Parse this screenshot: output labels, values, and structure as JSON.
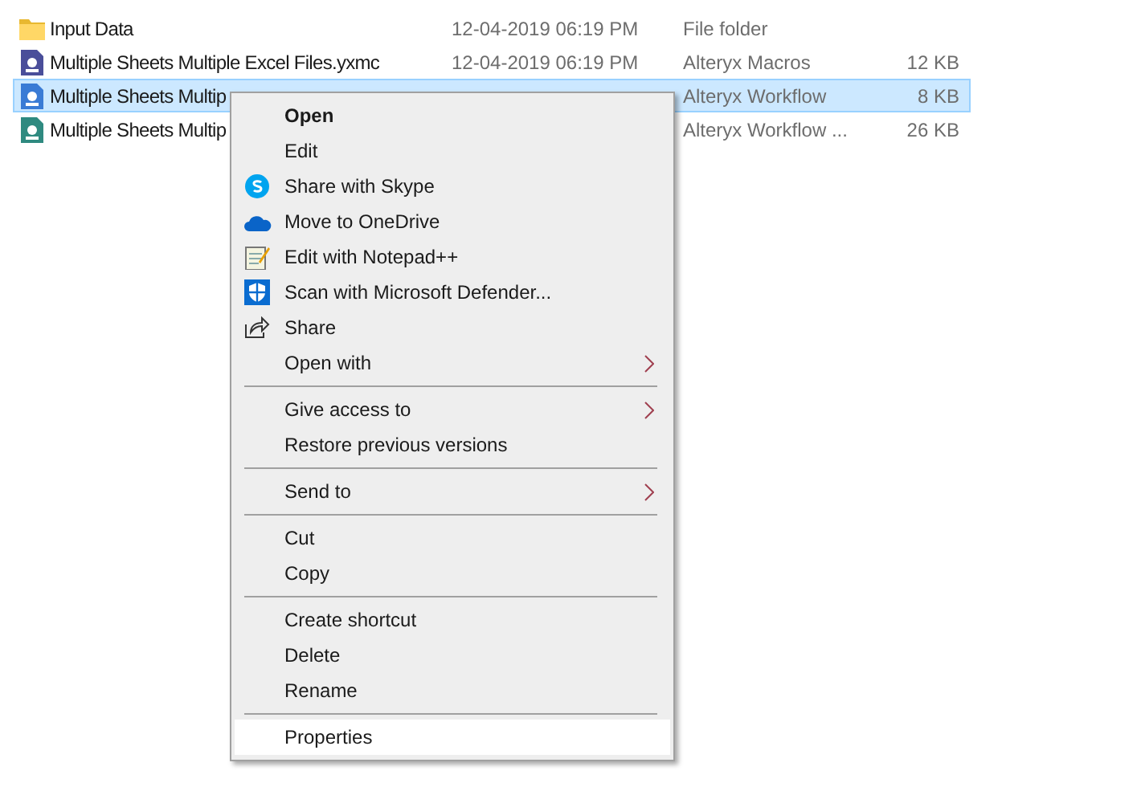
{
  "files": [
    {
      "name": "Input Data",
      "date": "12-04-2019 06:19 PM",
      "type": "File folder",
      "selected": false,
      "kind": "folder"
    },
    {
      "name": "Multiple Sheets Multiple Excel Files.yxmc",
      "date": "12-04-2019 06:19 PM",
      "type": "Alteryx Macros",
      "size": "12 KB",
      "selected": false,
      "kind": "macro"
    },
    {
      "name": "Multiple Sheets Multip",
      "type": "Alteryx Workflow",
      "size": "8 KB",
      "selected": true,
      "kind": "workflow"
    },
    {
      "name": "Multiple Sheets Multip",
      "type": "Alteryx Workflow ...",
      "size": "26 KB",
      "selected": false,
      "kind": "package"
    }
  ],
  "context_menu": {
    "items": [
      {
        "kind": "item",
        "label": "Open",
        "bold": true,
        "submenu": false,
        "selected": false
      },
      {
        "kind": "item",
        "label": "Edit",
        "bold": false,
        "submenu": false,
        "selected": false
      },
      {
        "kind": "item",
        "label": "Share with Skype",
        "bold": false,
        "submenu": false,
        "selected": false
      },
      {
        "kind": "item",
        "label": "Move to OneDrive",
        "bold": false,
        "submenu": false,
        "selected": false
      },
      {
        "kind": "item",
        "label": "Edit with Notepad++",
        "bold": false,
        "submenu": false,
        "selected": false
      },
      {
        "kind": "item",
        "label": "Scan with Microsoft Defender...",
        "bold": false,
        "submenu": false,
        "selected": false
      },
      {
        "kind": "item",
        "label": "Share",
        "bold": false,
        "submenu": false,
        "selected": false
      },
      {
        "kind": "item",
        "label": "Open with",
        "bold": false,
        "submenu": true,
        "selected": false
      },
      {
        "kind": "separator"
      },
      {
        "kind": "item",
        "label": "Give access to",
        "bold": false,
        "submenu": true,
        "selected": false
      },
      {
        "kind": "item",
        "label": "Restore previous versions",
        "bold": false,
        "submenu": false,
        "selected": false
      },
      {
        "kind": "separator"
      },
      {
        "kind": "item",
        "label": "Send to",
        "bold": false,
        "submenu": true,
        "selected": false
      },
      {
        "kind": "separator"
      },
      {
        "kind": "item",
        "label": "Cut",
        "bold": false,
        "submenu": false,
        "selected": false
      },
      {
        "kind": "item",
        "label": "Copy",
        "bold": false,
        "submenu": false,
        "selected": false
      },
      {
        "kind": "separator"
      },
      {
        "kind": "item",
        "label": "Create shortcut",
        "bold": false,
        "submenu": false,
        "selected": false
      },
      {
        "kind": "item",
        "label": "Delete",
        "bold": false,
        "submenu": false,
        "selected": false
      },
      {
        "kind": "item",
        "label": "Rename",
        "bold": false,
        "submenu": false,
        "selected": false
      },
      {
        "kind": "separator"
      },
      {
        "kind": "item",
        "label": "Properties",
        "bold": false,
        "submenu": false,
        "selected": true
      }
    ]
  }
}
